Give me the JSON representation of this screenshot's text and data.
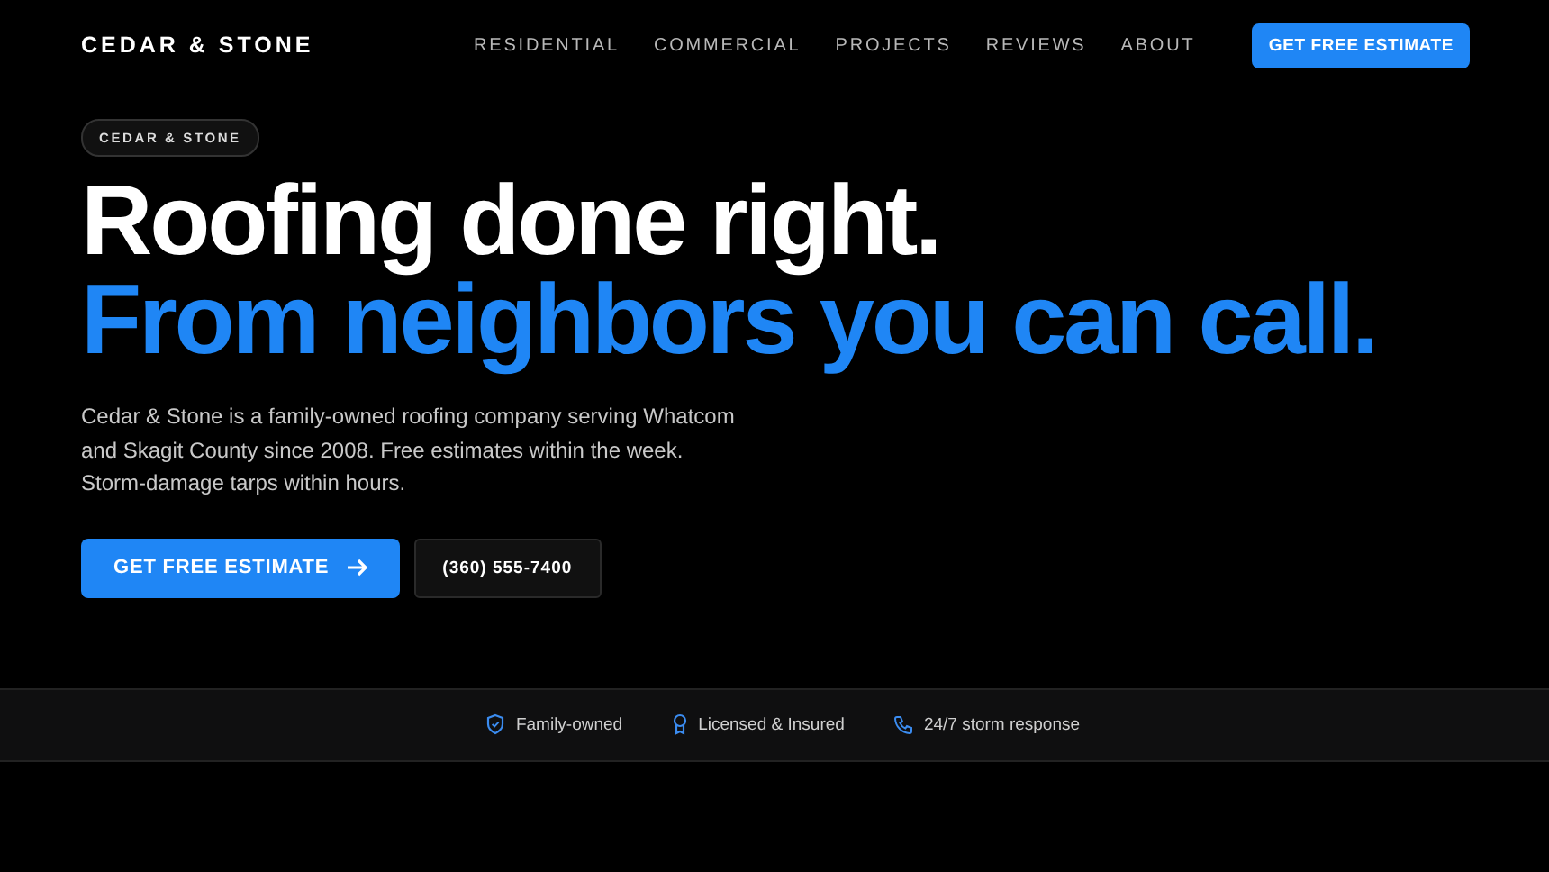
{
  "header": {
    "brand": "CEDAR & STONE",
    "nav": [
      "RESIDENTIAL",
      "COMMERCIAL",
      "PROJECTS",
      "REVIEWS",
      "ABOUT"
    ],
    "cta": "GET FREE ESTIMATE"
  },
  "hero": {
    "badge": "CEDAR & STONE",
    "headline": "Roofing done right.",
    "headline_accent": "From neighbors you can call.",
    "body": "Cedar & Stone is a family-owned roofing company serving Whatcom and Skagit County since 2008. Free estimates within the week. Storm-damage tarps within hours.",
    "primary_button": "GET FREE ESTIMATE",
    "phone_button": "(360) 555-7400"
  },
  "trust_bar": [
    {
      "kind": "shield",
      "label": "Family-owned"
    },
    {
      "kind": "ribbon",
      "label": "Licensed & Insured"
    },
    {
      "kind": "phone",
      "label": "24/7 storm response"
    }
  ]
}
